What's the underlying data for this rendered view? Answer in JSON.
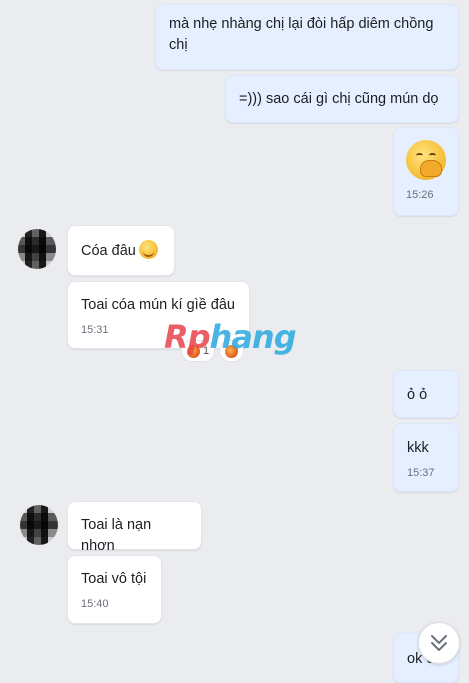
{
  "messages": {
    "m1": {
      "text": "mà nhẹ nhàng chị lại đòi hấp diêm chồng chị"
    },
    "m2": {
      "text": "=))) sao cái gì chị cũng mún dọ"
    },
    "m3": {
      "emoji": "hand-over-mouth-emoji",
      "time": "15:26"
    },
    "m4": {
      "text": "Cóa đâu",
      "emoji": "smiling-blush-emoji"
    },
    "m5": {
      "text": "Toai cóa mún kí gìề đâu",
      "time": "15:31"
    },
    "m6": {
      "text": "ỏ ỏ"
    },
    "m7": {
      "text": "kkk",
      "time": "15:37"
    },
    "m8": {
      "text": "Toai là nạn nhơn"
    },
    "m9": {
      "text": "Toai vô tội",
      "time": "15:40"
    },
    "m10": {
      "text": "ok c"
    }
  },
  "reactions": {
    "count": "1"
  },
  "watermark": {
    "part1": "Rp",
    "part2": "hang"
  },
  "colors": {
    "my_bubble": "#e5efff",
    "their_bubble": "#ffffff",
    "background": "#ebecf0"
  },
  "icons": {
    "scroll_down": "double-chevron-down-icon"
  }
}
